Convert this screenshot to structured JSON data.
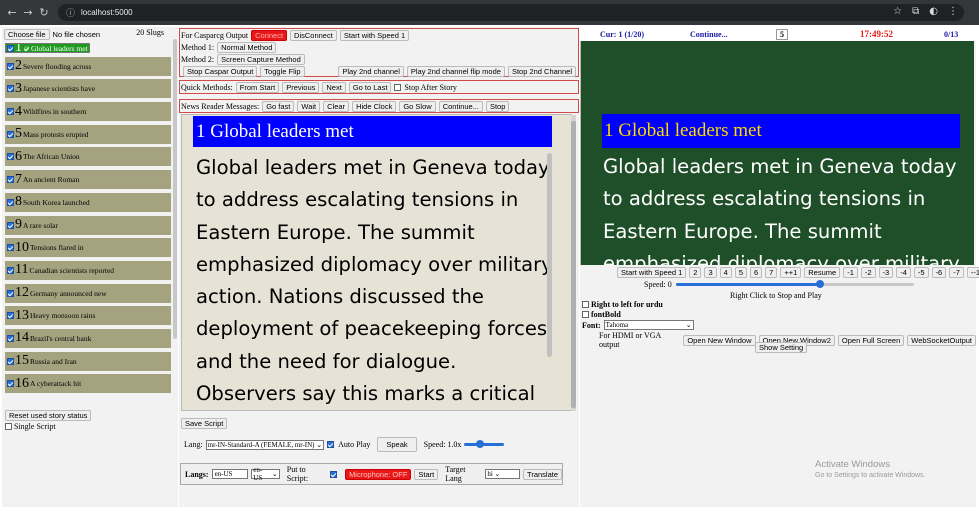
{
  "browser": {
    "url": "localhost:5000"
  },
  "left": {
    "choose_file": "Choose file",
    "no_file": "No file chosen",
    "slug_count": "20 Slugs",
    "slugs": [
      {
        "num": "1",
        "title": "Global leaders met"
      },
      {
        "num": "2",
        "title": "Severe flooding across"
      },
      {
        "num": "3",
        "title": "Japanese scientists have"
      },
      {
        "num": "4",
        "title": "Wildfires in southern"
      },
      {
        "num": "5",
        "title": "Mass protests erupted"
      },
      {
        "num": "6",
        "title": "The African Union"
      },
      {
        "num": "7",
        "title": "An ancient Roman"
      },
      {
        "num": "8",
        "title": "South Korea launched"
      },
      {
        "num": "9",
        "title": "A rare solar"
      },
      {
        "num": "10",
        "title": "Tensions flared in"
      },
      {
        "num": "11",
        "title": "Canadian scientists reported"
      },
      {
        "num": "12",
        "title": "Germany announced new"
      },
      {
        "num": "13",
        "title": "Heavy monsoon rains"
      },
      {
        "num": "14",
        "title": "Brazil's central bank"
      },
      {
        "num": "15",
        "title": "Russia and Iran"
      },
      {
        "num": "16",
        "title": "A cyberattack hit"
      }
    ],
    "reset_btn": "Reset used story status",
    "single_script": "Single Script"
  },
  "caspar": {
    "label": "For Casparcg Output",
    "connect": "Connect",
    "disconnect": "DisConnect",
    "start_speed": "Start with Speed 1",
    "method1_label": "Method 1:",
    "method1_btn": "Normal Method",
    "method2_label": "Method 2:",
    "method2_btn": "Screen Capture Method",
    "stop_caspar": "Stop Caspar Output",
    "toggle_flip": "Toggle Flip",
    "play_2nd": "Play 2nd channel",
    "play_2nd_flip": "Play 2nd channel flip mode",
    "stop_2nd": "Stop 2nd Channel"
  },
  "quick": {
    "label": "Quick Methods:",
    "from_start": "From Start",
    "previous": "Previous",
    "next": "Next",
    "go_last": "Go to Last",
    "stop_after": "Stop After Story"
  },
  "news": {
    "label": "News Reader Messages:",
    "go_fast": "Go fast",
    "wait": "Wait",
    "clear": "Clear",
    "hide_clock": "Hide Clock",
    "go_slow": "Go Slow",
    "continue": "Continue...",
    "stop": "Stop"
  },
  "editor": {
    "title": "1 Global leaders met",
    "body": "Global leaders met in Geneva today to address escalating tensions in Eastern Europe. The summit emphasized diplomacy over military action. Nations discussed the deployment of peacekeeping forces and the need for dialogue. Observers say this marks a critical"
  },
  "speech": {
    "save_script": "Save Script",
    "lang_label": "Lang:",
    "voice": "mr-IN-Standard-A (FEMALE, mr-IN)",
    "auto_play": "Auto Play",
    "speak": "Speak",
    "speed_label": "Speed: 1.0x",
    "speed_value": 1.0
  },
  "langs": {
    "label": "Langs:",
    "lang_input": "en-US",
    "lang_select": "en-US",
    "put_to_script": "Put to Script:",
    "mic": "Microphone: OFF",
    "start": "Start",
    "target_label": "Target Lang",
    "target": "hi",
    "translate": "Translate"
  },
  "status": {
    "current": "Cur: 1 (1/20)",
    "continue": "Continue...",
    "count": "5",
    "clock": "17:49:52",
    "progress": "0/13"
  },
  "preview": {
    "title": "1 Global leaders met",
    "body": "Global leaders met in Geneva today to address escalating tensions in Eastern Europe. The summit emphasized diplomacy over military"
  },
  "playback": {
    "buttons": [
      "Start with Speed 1",
      "2",
      "3",
      "4",
      "5",
      "6",
      "7",
      "++1",
      "Resume",
      "-1",
      "-2",
      "-3",
      "-4",
      "-5",
      "-6",
      "-7",
      "--1"
    ],
    "speed_label": "Speed: 0",
    "speed_value": 0.6,
    "right_click": "Right Click to Stop and Play",
    "rtl_urdu": "Right to left for urdu",
    "font_bold": "fontBold",
    "font_label": "Font:",
    "font_value": "Tahoma",
    "hdmi_label": "For HDMI or VGA output",
    "open_new_window": "Open New Window",
    "open_new_window2": "Open New Window2",
    "open_full_screen": "Open Full Screen",
    "websocket": "WebSocketOutput",
    "show_setting": "Show Setting"
  },
  "watermark": {
    "line1": "Activate Windows",
    "line2": "Go to Settings to activate Windows."
  },
  "colors": {
    "accent_blue": "#0000ff",
    "preview_bg": "#1f4f28",
    "slug_selected": "#1f9b1f",
    "slug_bg": "#a5a27f",
    "alert_red": "#e81818"
  }
}
